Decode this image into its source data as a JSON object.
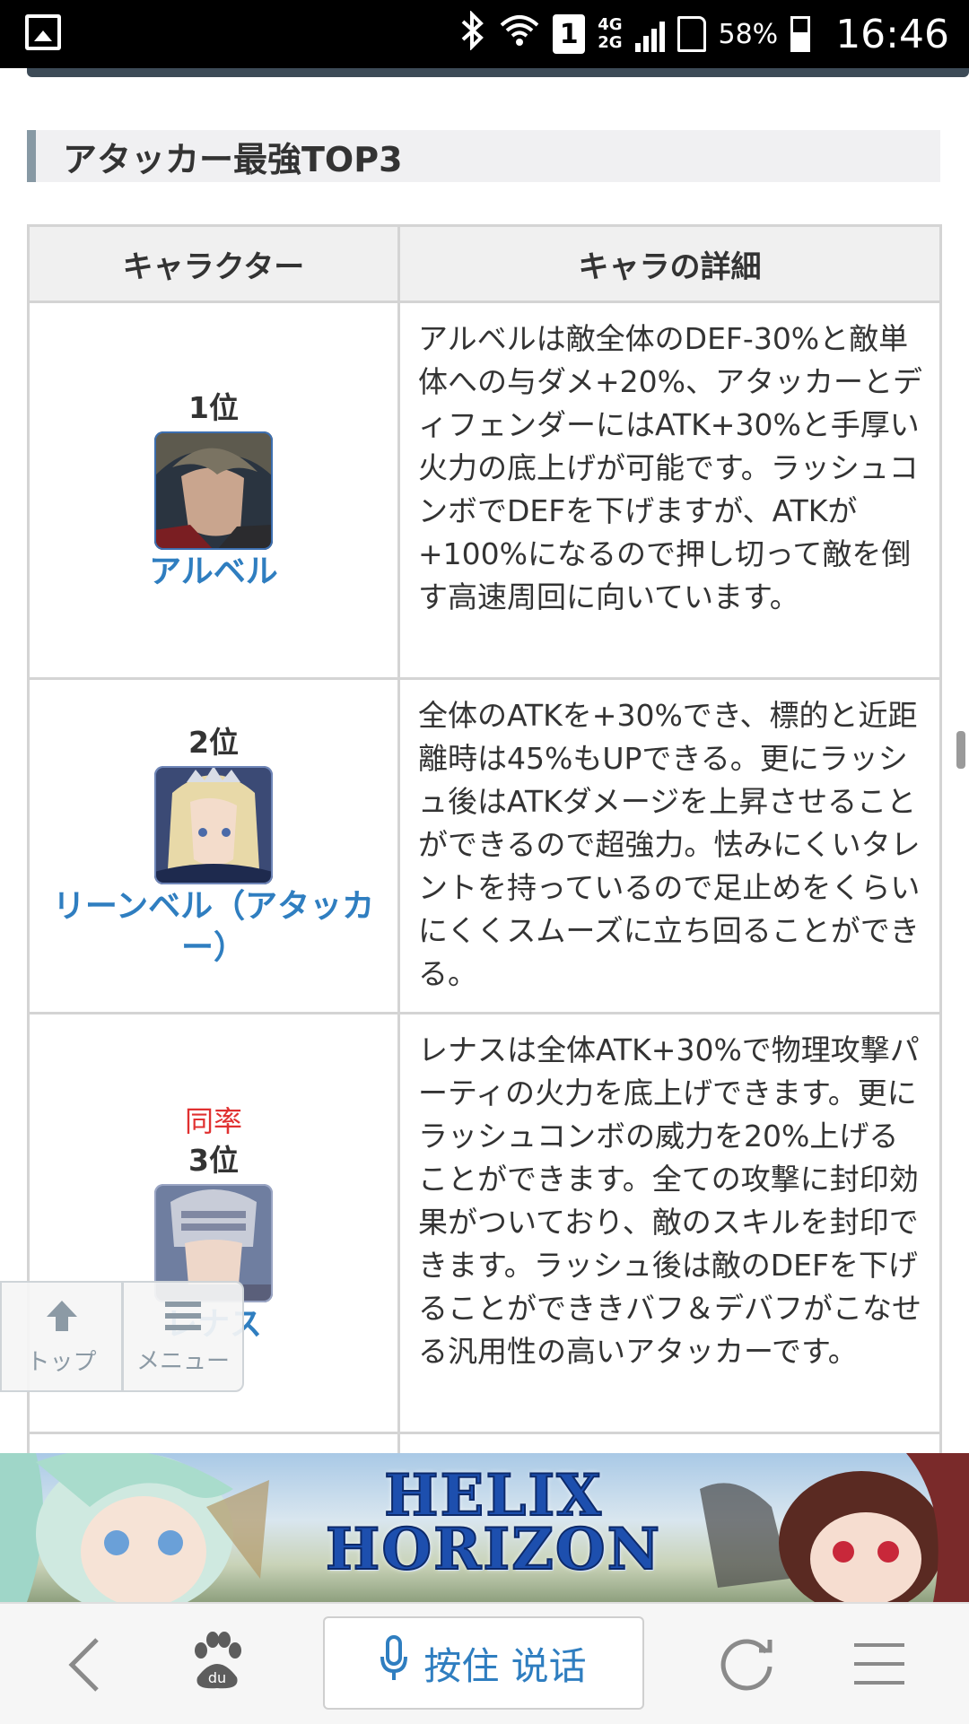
{
  "status_bar": {
    "network_top": "4G",
    "network_bottom": "2G",
    "sim_slot": "1",
    "battery": "58%",
    "time": "16:46"
  },
  "section": {
    "heading": "アタッカー最強TOP3"
  },
  "table": {
    "headers": [
      "キャラクター",
      "キャラの詳細"
    ],
    "rows": [
      {
        "tie": "",
        "rank": "1位",
        "name": "アルベル",
        "detail": "アルベルは敵全体のDEF-30%と敵単体への与ダメ+20%、アタッカーとディフェンダーにはATK+30%と手厚い火力の底上げが可能です。ラッシュコンボでDEFを下げますが、ATKが+100%になるので押し切って敵を倒す高速周回に向いています。"
      },
      {
        "tie": "",
        "rank": "2位",
        "name": "リーンベル（アタッカー）",
        "detail": "全体のATKを+30%でき、標的と近距離時は45%もUPできる。更にラッシュ後はATKダメージを上昇させることができるので超強力。怯みにくいタレントを持っているので足止めをくらいにくくスムーズに立ち回ることができる。"
      },
      {
        "tie": "同率",
        "rank": "3位",
        "name": "レナス",
        "detail": "レナスは全体ATK+30%で物理攻撃パーティの火力を底上げできます。更にラッシュコンボの威力を20%上げることができます。全ての攻撃に封印効果がついており、敵のスキルを封印できます。ラッシュ後は敵のDEFを下げることができきバフ＆デバフがこなせる汎用性の高いアタッカーです。"
      }
    ]
  },
  "float_nav": {
    "top_label": "トップ",
    "menu_label": "メニュー"
  },
  "banner": {
    "title_line1": "HELIX",
    "title_line2": "HORIZON"
  },
  "browser_bar": {
    "voice_label": "按住 说话",
    "logo_text": "du"
  },
  "colors": {
    "link": "#2f7ec0",
    "tie": "#e03030",
    "heading_bar": "#8799a4"
  },
  "icons": [
    "gallery-icon",
    "bluetooth-icon",
    "wifi-icon",
    "signal-icon",
    "sd-card-icon",
    "battery-icon",
    "arrow-up-icon",
    "menu-icon",
    "back-icon",
    "baidu-paw-icon",
    "microphone-icon",
    "refresh-icon",
    "hamburger-icon"
  ]
}
